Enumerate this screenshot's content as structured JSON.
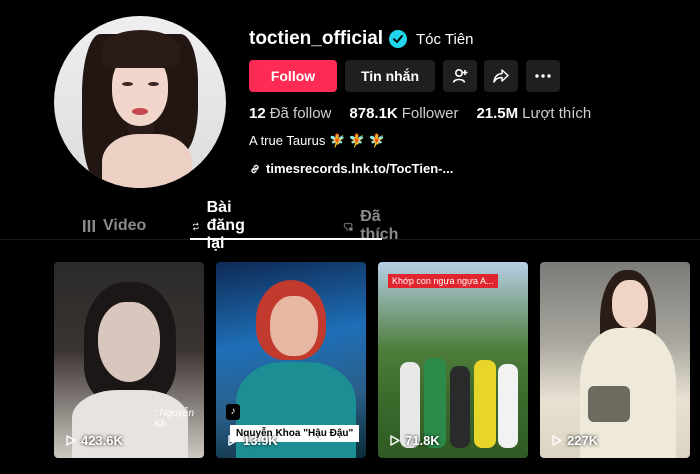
{
  "profile": {
    "username": "toctien_official",
    "nickname": "Tóc Tiên",
    "bio": "A true Taurus 🧚 🧚 🧚",
    "link": "timesrecords.lnk.to/TocTien-..."
  },
  "actions": {
    "follow_label": "Follow",
    "message_label": "Tin nhắn"
  },
  "stats": {
    "following_count": "12",
    "following_label": "Đã follow",
    "followers_count": "878.1K",
    "followers_label": "Follower",
    "likes_count": "21.5M",
    "likes_label": "Lượt thích"
  },
  "tabs": [
    {
      "label": "Video",
      "icon": "grid-icon"
    },
    {
      "label": "Bài đăng lại",
      "icon": "repost-icon"
    },
    {
      "label": "Đã thích",
      "icon": "heart-lock-icon"
    }
  ],
  "videos": [
    {
      "views": "423.6K",
      "overlay": ": Nguyễn Kh"
    },
    {
      "views": "13.9K",
      "overlay": "Nguyễn Khoa \"Hậu Đậu\""
    },
    {
      "views": "71.8K",
      "overlay": "Khớp con ngựa ngựa A..."
    },
    {
      "views": "227K",
      "overlay": ""
    }
  ],
  "colors": {
    "accent": "#fe2c55",
    "verified": "#20d5ec",
    "background": "#000000"
  }
}
